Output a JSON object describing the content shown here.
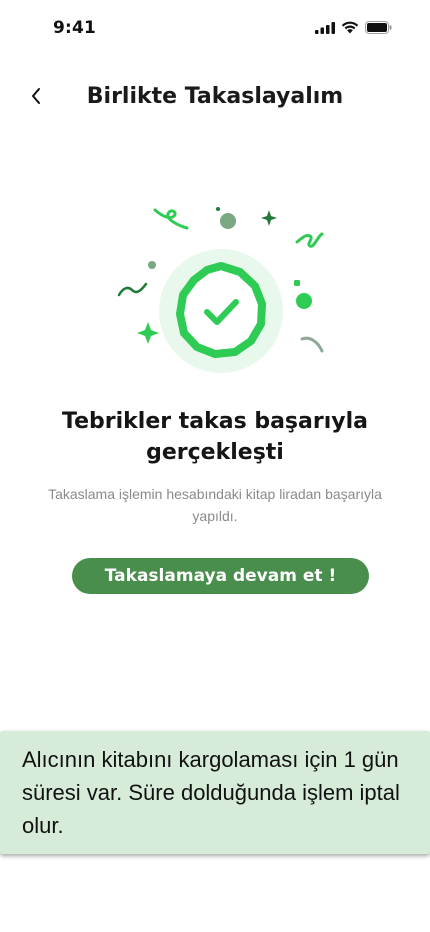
{
  "status_bar": {
    "time": "9:41",
    "icons": [
      "signal-icon",
      "wifi-icon",
      "battery-icon"
    ]
  },
  "header": {
    "title": "Birlikte Takaslayalım",
    "back_icon": "chevron-left-icon"
  },
  "illustration": {
    "icon": "check-badge-icon",
    "colors": {
      "primary_green": "#2ecc55",
      "light_green_bg": "#e8f8ec",
      "dark_green": "#1e7a36",
      "muted_green": "#7aa883",
      "gray_green": "#8fa898"
    }
  },
  "success": {
    "title": "Tebrikler takas başarıyla gerçekleşti",
    "subtitle": "Takaslama işlemin hesabındaki kitap liradan başarıyla yapıldı."
  },
  "actions": {
    "continue_label": "Takaslamaya devam et !"
  },
  "info_banner": {
    "text": "Alıcının kitabını kargolaması için 1 gün süresi var. Süre dolduğunda işlem iptal olur."
  },
  "colors": {
    "button_green": "#4a8e4e",
    "banner_bg": "#d6ecd8"
  }
}
